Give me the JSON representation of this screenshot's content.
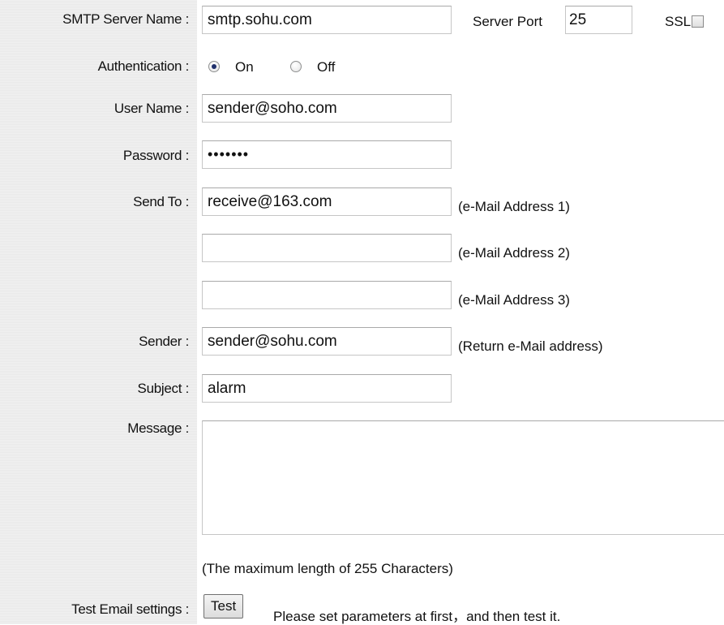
{
  "smtp": {
    "label": "SMTP Server Name :",
    "value": "smtp.sohu.com",
    "port_label": "Server Port",
    "port_value": "25",
    "ssl_label": "SSL",
    "ssl_checked": false
  },
  "auth": {
    "label": "Authentication :",
    "on_label": "On",
    "off_label": "Off",
    "selected": "On"
  },
  "user": {
    "label": "User Name :",
    "value": "sender@soho.com"
  },
  "password": {
    "label": "Password :",
    "value": "•••••••"
  },
  "send_to": {
    "label": "Send To :",
    "addresses": [
      {
        "value": "receive@163.com",
        "hint": "(e-Mail Address 1)"
      },
      {
        "value": "",
        "hint": "(e-Mail Address 2)"
      },
      {
        "value": "",
        "hint": "(e-Mail Address 3)"
      }
    ]
  },
  "sender": {
    "label": "Sender :",
    "value": "sender@sohu.com",
    "hint": "(Return e-Mail address)"
  },
  "subject": {
    "label": "Subject :",
    "value": "alarm"
  },
  "message": {
    "label": "Message :",
    "value": "",
    "note": "(The maximum length of 255 Characters)"
  },
  "test": {
    "label": "Test Email settings :",
    "button_label": "Test",
    "hint": "Please set parameters at first，and then test it."
  }
}
